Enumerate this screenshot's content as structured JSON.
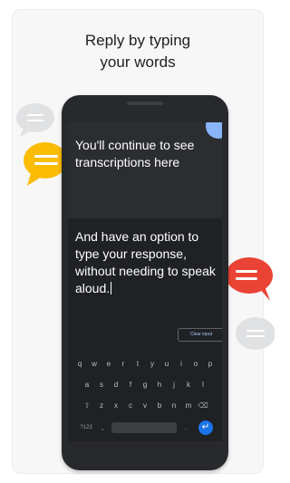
{
  "headline": {
    "line1": "Reply by typing",
    "line2": "your words"
  },
  "screen": {
    "transcription_text": "You'll continue to see transcriptions here",
    "typed_text": "And have an option to type your response, without needing to speak aloud.",
    "clear_button_label": "Clear input"
  },
  "keyboard": {
    "row1": [
      "q",
      "w",
      "e",
      "r",
      "t",
      "y",
      "u",
      "i",
      "o",
      "p"
    ],
    "row2": [
      "a",
      "s",
      "d",
      "f",
      "g",
      "h",
      "j",
      "k",
      "l"
    ],
    "row3": [
      "z",
      "x",
      "c",
      "v",
      "b",
      "n",
      "m"
    ],
    "shift_glyph": "⇧",
    "backspace_glyph": "⌫",
    "symbols_label": "?123",
    "comma_label": ",",
    "period_label": ".",
    "enter_glyph": "↵"
  },
  "colors": {
    "accent_yellow": "#fbbc04",
    "accent_red": "#ea4335",
    "bubble_gray": "#e0e1e3",
    "enter_blue": "#1a73e8",
    "corner_blue": "#8ab4f8"
  },
  "icons": [
    "chat-bubble-gray-icon",
    "chat-bubble-yellow-icon",
    "chat-bubble-red-icon",
    "chat-bubble-gray-small-icon"
  ]
}
